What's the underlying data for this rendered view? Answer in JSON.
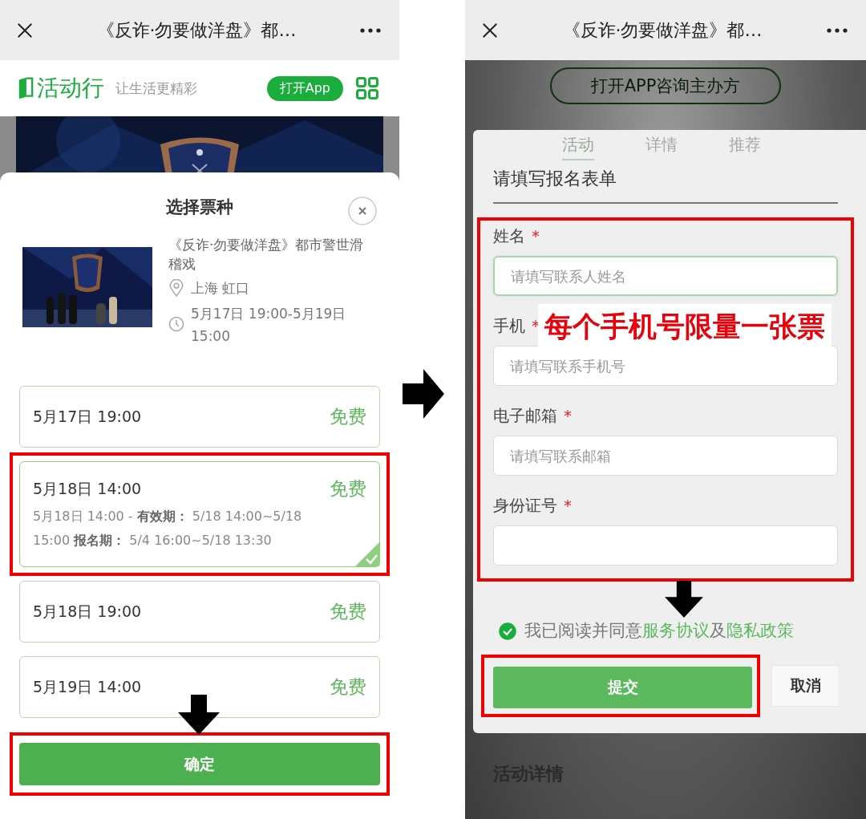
{
  "left_screen": {
    "top_bar": {
      "title": "《反诈·勿要做洋盘》都…"
    },
    "app_bar": {
      "brand": "活动行",
      "slogan": "让生活更精彩",
      "open_app": "打开App"
    },
    "sheet": {
      "title": "选择票种",
      "event": {
        "title": "《反诈·勿要做洋盘》都市警世滑稽戏",
        "location": "上海 虹口",
        "time": "5月17日 19:00-5月19日 15:00"
      },
      "tickets": [
        {
          "time": "5月17日 19:00",
          "price": "免费",
          "selected": false,
          "highlighted": false
        },
        {
          "time": "5月18日 14:00",
          "price": "免费",
          "detail": "5月18日 14:00 - **有效期：** 5/18 14:00~5/18 15:00  **报名期：** 5/4 16:00~5/18 13:30",
          "selected": true,
          "highlighted": true
        },
        {
          "time": "5月18日 19:00",
          "price": "免费",
          "selected": false,
          "highlighted": false
        },
        {
          "time": "5月19日 14:00",
          "price": "免费",
          "selected": false,
          "highlighted": false
        }
      ],
      "confirm_button": {
        "label": "确定",
        "highlighted": true
      }
    }
  },
  "right_screen": {
    "top_bar": {
      "title": "《反诈·勿要做洋盘》都…"
    },
    "consult_button": "打开APP咨询主办方",
    "tabs": [
      {
        "label": "活动",
        "selected": true
      },
      {
        "label": "详情",
        "selected": false
      },
      {
        "label": "推荐",
        "selected": false
      }
    ],
    "form": {
      "title": "请填写报名表单",
      "highlighted": true,
      "required_mark": "*",
      "note": "每个手机号限量一张票",
      "fields": [
        {
          "label": "姓名",
          "required": true,
          "placeholder": "请填写联系人姓名",
          "focused": true
        },
        {
          "label": "手机",
          "required": true,
          "placeholder": "请填写联系手机号",
          "focused": false
        },
        {
          "label": "电子邮箱",
          "required": true,
          "placeholder": "请填写联系邮箱",
          "focused": false
        },
        {
          "label": "身份证号",
          "required": true,
          "focused": false
        }
      ]
    },
    "agreement": {
      "checked": true,
      "parts": [
        {
          "kind": "text",
          "text": "我已阅读并同意"
        },
        {
          "kind": "link",
          "text": "服务协议"
        },
        {
          "kind": "text",
          "text": "及"
        },
        {
          "kind": "link",
          "text": "隐私政策"
        }
      ]
    },
    "submit_button": {
      "label": "提交",
      "highlighted": true
    },
    "cancel_button": {
      "label": "取消"
    },
    "section_title": "活动详情"
  }
}
